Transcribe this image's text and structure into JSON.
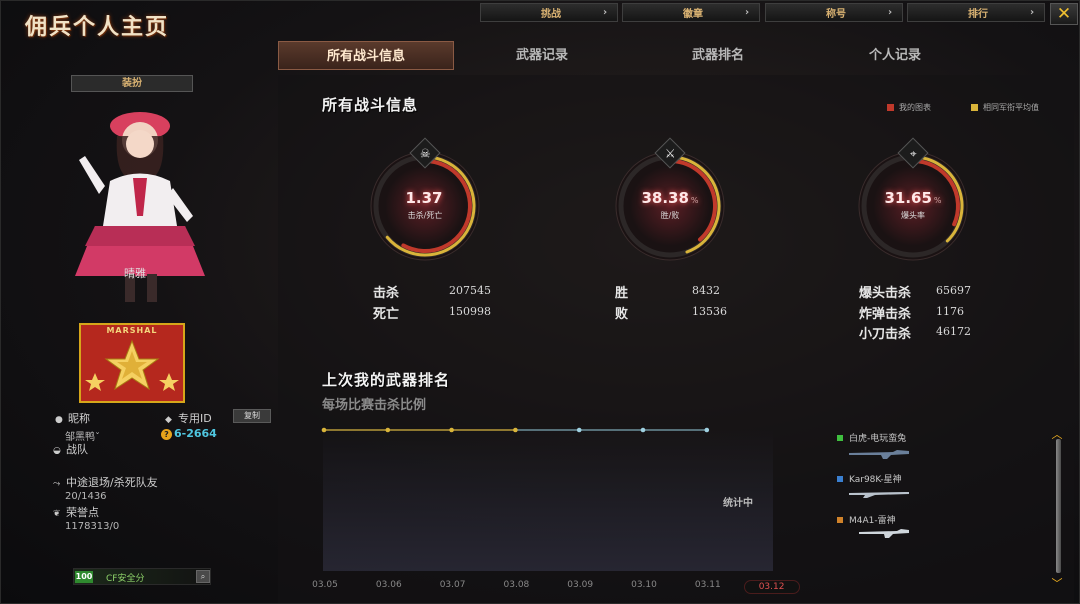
{
  "window": {
    "title": "佣兵个人主页",
    "close_symbol": "✕"
  },
  "top_tabs": [
    {
      "label": "挑战"
    },
    {
      "label": "徽章"
    },
    {
      "label": "称号"
    },
    {
      "label": "排行"
    }
  ],
  "main_tabs": [
    {
      "label": "所有战斗信息",
      "active": true
    },
    {
      "label": "武器记录",
      "active": false
    },
    {
      "label": "武器排名",
      "active": false
    },
    {
      "label": "个人记录",
      "active": false
    }
  ],
  "left": {
    "outfit_button": "装扮",
    "character_name": "晴雅",
    "rank_badge_text": "MARSHAL",
    "nickname_label": "昵称",
    "nickname_value": "邹黑鸭ˇ",
    "id_label": "专用ID",
    "id_value": "6-2664",
    "id_prefix_icon": "?",
    "copy_button": "复制",
    "clan_label": "战队",
    "quit_label": "中途退场/杀死队友",
    "quit_value": "20/1436",
    "honor_label": "荣誉点",
    "honor_value": "1178313/0",
    "safety_score": "100",
    "safety_label": "CF安全分"
  },
  "battle_info": {
    "title": "所有战斗信息",
    "legend": [
      {
        "label": "我的图表",
        "color": "#c0392b"
      },
      {
        "label": "相同军衔平均值",
        "color": "#d9b43a"
      }
    ],
    "gauges": [
      {
        "icon": "skull-crossbones-icon",
        "value": "1.37",
        "suffix": "",
        "label": "击杀/死亡",
        "fill": 0.58
      },
      {
        "icon": "crossed-swords-icon",
        "value": "38.38",
        "suffix": "%",
        "label": "胜/败",
        "fill": 0.3838
      },
      {
        "icon": "crosshair-rifle-icon",
        "value": "31.65",
        "suffix": "%",
        "label": "爆头率",
        "fill": 0.3165
      }
    ],
    "stats": {
      "kills_label": "击杀",
      "kills": "207545",
      "deaths_label": "死亡",
      "deaths": "150998",
      "wins_label": "胜",
      "wins": "8432",
      "losses_label": "败",
      "losses": "13536",
      "headshot_label": "爆头击杀",
      "headshot": "65697",
      "grenade_label": "炸弹击杀",
      "grenade": "1176",
      "knife_label": "小刀击杀",
      "knife": "46172"
    }
  },
  "weapon_rank": {
    "title": "上次我的武器排名",
    "subtitle": "每场比赛击杀比例",
    "pending_text": "统计中",
    "dates": [
      "03.05",
      "03.06",
      "03.07",
      "03.08",
      "03.09",
      "03.10",
      "03.11",
      "03.12"
    ],
    "active_date": "03.12",
    "weapons": [
      {
        "name": "白虎-电玩蛮兔",
        "color": "#3fbf3f"
      },
      {
        "name": "Kar98K-星神",
        "color": "#3a7fd0"
      },
      {
        "name": "M4A1-雷神",
        "color": "#d0822a"
      }
    ]
  },
  "chart_data": {
    "type": "line",
    "title": "每场比赛击杀比例",
    "categories": [
      "03.05",
      "03.06",
      "03.07",
      "03.08",
      "03.09",
      "03.10",
      "03.11"
    ],
    "series": [
      {
        "name": "白虎-电玩蛮兔",
        "values": [
          0,
          0,
          0,
          0,
          0,
          0,
          0
        ]
      }
    ],
    "ylim": [
      0,
      1
    ],
    "grid": false
  }
}
